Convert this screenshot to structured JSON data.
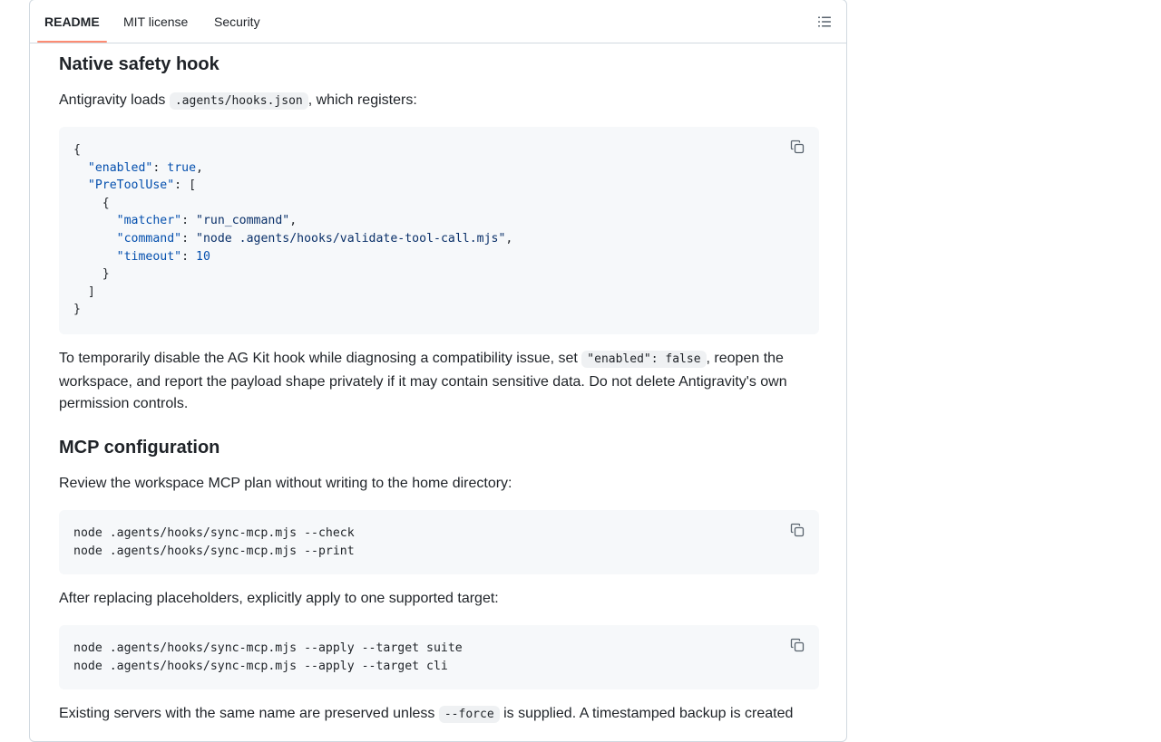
{
  "tabs": [
    {
      "label": "README",
      "active": true
    },
    {
      "label": "MIT license",
      "active": false
    },
    {
      "label": "Security",
      "active": false
    }
  ],
  "outline_icon": "list-unordered-icon",
  "sections": {
    "hook": {
      "title": "Native safety hook",
      "intro_before": "Antigravity loads ",
      "intro_code": ".agents/hooks.json",
      "intro_after": ", which registers:",
      "json": {
        "open": "{",
        "enabled_key": "\"enabled\"",
        "enabled_val": "true",
        "pretool_key": "\"PreToolUse\"",
        "bracket_open": "[",
        "obj_open": "{",
        "matcher_key": "\"matcher\"",
        "matcher_val": "\"run_command\"",
        "command_key": "\"command\"",
        "command_val": "\"node .agents/hooks/validate-tool-call.mjs\"",
        "timeout_key": "\"timeout\"",
        "timeout_val": "10",
        "obj_close": "}",
        "bracket_close": "]",
        "close": "}"
      },
      "para_before": "To temporarily disable the AG Kit hook while diagnosing a compatibility issue, set ",
      "para_code": "\"enabled\": false",
      "para_after": ", reopen the workspace, and report the payload shape privately if it may contain sensitive data. Do not delete Antigravity's own permission controls."
    },
    "mcp": {
      "title": "MCP configuration",
      "intro": "Review the workspace MCP plan without writing to the home directory:",
      "code1": [
        "node .agents/hooks/sync-mcp.mjs --check",
        "node .agents/hooks/sync-mcp.mjs --print"
      ],
      "apply_intro": "After replacing placeholders, explicitly apply to one supported target:",
      "code2": [
        "node .agents/hooks/sync-mcp.mjs --apply --target suite",
        "node .agents/hooks/sync-mcp.mjs --apply --target cli"
      ],
      "final_before": "Existing servers with the same name are preserved unless ",
      "final_code": "--force",
      "final_after": " is supplied. A timestamped backup is created"
    }
  },
  "copy_icon": "copy-icon",
  "colors": {
    "accent_underline": "#fd8c73",
    "code_bg": "#f6f8fa",
    "json_key": "#0550ae",
    "json_string": "#0a3069"
  }
}
